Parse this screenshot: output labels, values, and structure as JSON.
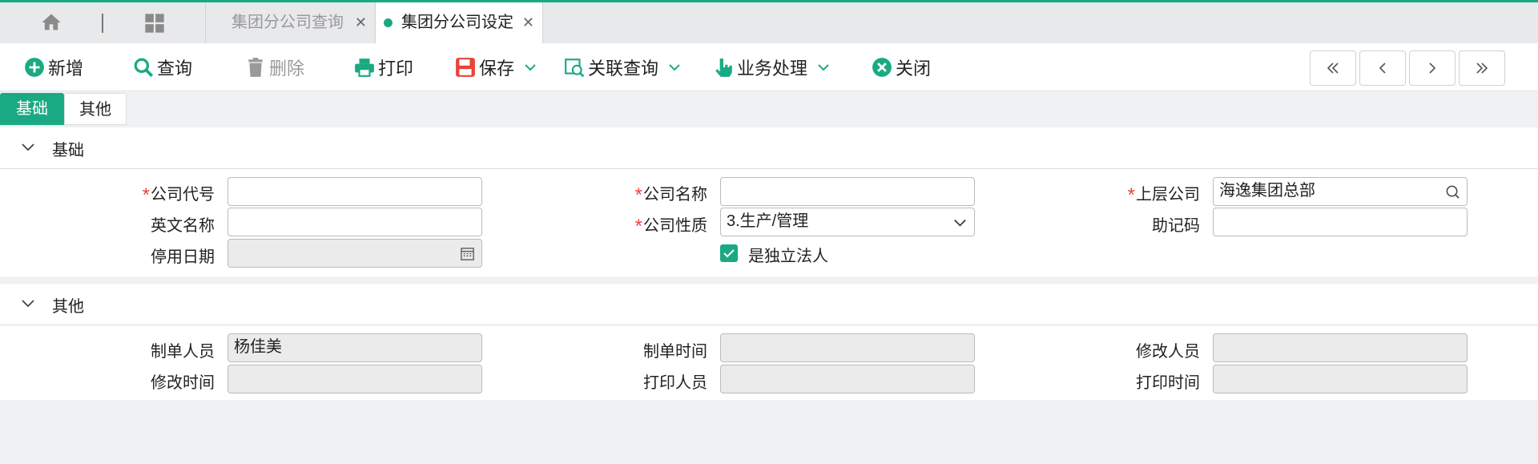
{
  "tabs": [
    {
      "label": "集团分公司查询",
      "active": false
    },
    {
      "label": "集团分公司设定",
      "active": true
    }
  ],
  "toolbar": {
    "add": "新增",
    "query": "查询",
    "delete": "删除",
    "print": "打印",
    "save": "保存",
    "related_query": "关联查询",
    "business": "业务处理",
    "close": "关闭"
  },
  "section_tabs": [
    "基础",
    "其他"
  ],
  "basic": {
    "title": "基础",
    "company_code_label": "公司代号",
    "company_code": "",
    "company_name_label": "公司名称",
    "company_name": "",
    "parent_company_label": "上层公司",
    "parent_company": "海逸集团总部",
    "english_name_label": "英文名称",
    "english_name": "",
    "company_type_label": "公司性质",
    "company_type": "3.生产/管理",
    "mnemonic_label": "助记码",
    "mnemonic": "",
    "disable_date_label": "停用日期",
    "disable_date": "",
    "independent_label": "是独立法人",
    "independent": true
  },
  "other": {
    "title": "其他",
    "creator_label": "制单人员",
    "creator": "杨佳美",
    "create_time_label": "制单时间",
    "create_time": "",
    "modifier_label": "修改人员",
    "modifier": "",
    "modify_time_label": "修改时间",
    "modify_time": "",
    "printer_label": "打印人员",
    "printer": "",
    "print_time_label": "打印时间",
    "print_time": ""
  },
  "colors": {
    "accent": "#1aaa83",
    "required": "#e8443a",
    "save_icon": "#e8443a"
  }
}
